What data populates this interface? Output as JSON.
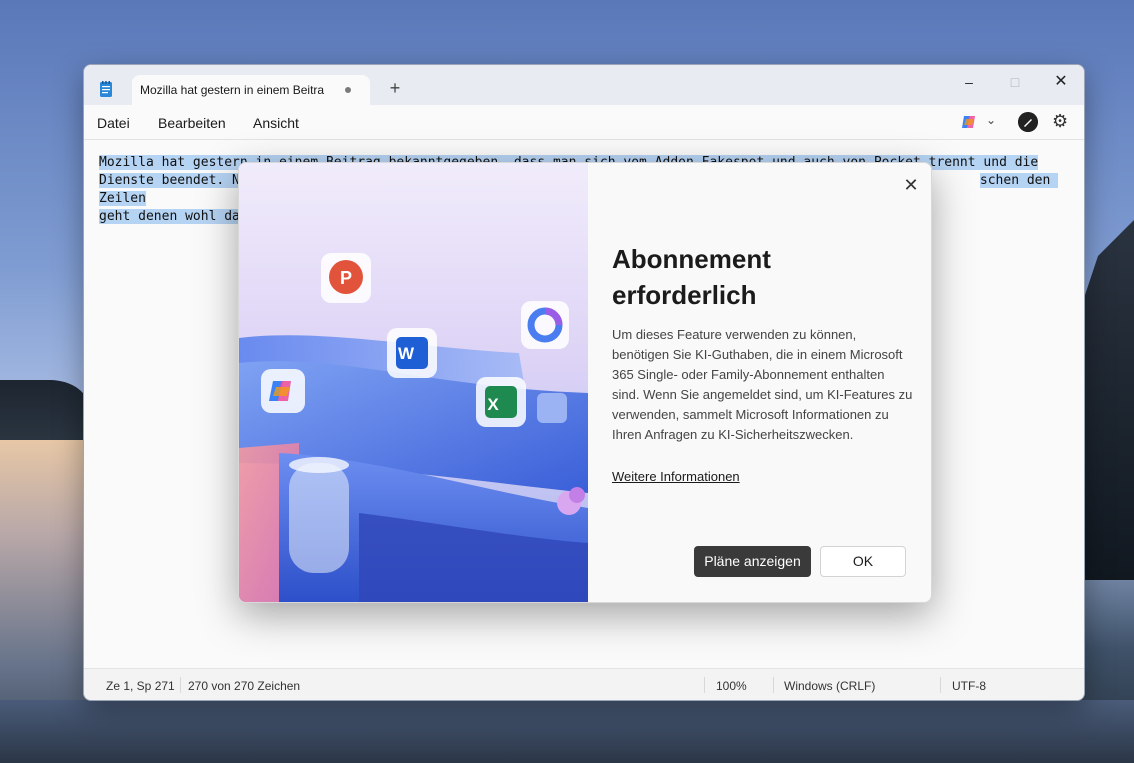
{
  "window": {
    "tab_title": "Mozilla hat gestern in einem Beitra",
    "new_tab_glyph": "+",
    "minimize_glyph": "–",
    "maximize_glyph": "□",
    "close_glyph": "✕"
  },
  "menu": {
    "items": [
      "Datei",
      "Bearbeiten",
      "Ansicht"
    ]
  },
  "editor": {
    "line1": "Mozilla hat gestern in einem Beitrag bekanntgegeben, dass man sich vom Addon Fakespot und auch von Pocket trennt und die",
    "line2_start": "Dienste beendet. N",
    "line2_end": "schen den Zeilen",
    "line3_start": "geht denen wohl da"
  },
  "status": {
    "position": "Ze 1, Sp 271",
    "chars": "270 von 270 Zeichen",
    "zoom": "100%",
    "line_ending": "Windows (CRLF)",
    "encoding": "UTF-8"
  },
  "dialog": {
    "title": "Abonnement erforderlich",
    "body": "Um dieses Feature verwenden zu können, benötigen Sie KI-Guthaben, die in einem Microsoft 365 Single- oder Family-Abonnement enthalten sind. Wenn Sie angemeldet sind, um KI-Features zu verwenden, sammelt Microsoft Informationen zu Ihren Anfragen zu KI-Sicherheitszwecken.",
    "link": "Weitere Informationen",
    "primary_button": "Pläne anzeigen",
    "secondary_button": "OK",
    "close_glyph": "✕"
  },
  "art_letters": {
    "powerpoint": "P",
    "word": "W",
    "excel": "X"
  },
  "colors": {
    "selection": "#b5d3f3",
    "primary_button_bg": "#3a3a3a"
  }
}
